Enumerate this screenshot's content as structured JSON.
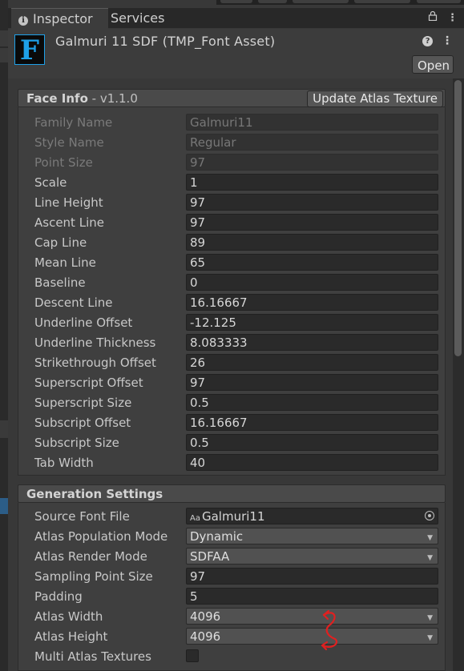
{
  "tabs": [
    {
      "label": "Inspector",
      "icon": "info-icon",
      "active": true
    },
    {
      "label": "Services",
      "active": false
    }
  ],
  "header": {
    "icon_letter": "F",
    "title": "Galmuri 11 SDF (TMP_Font Asset)",
    "open_label": "Open",
    "icons": [
      "help-icon",
      "more-icon"
    ]
  },
  "face_info": {
    "title": "Face Info",
    "version": " - v1.1.0",
    "update_label": "Update Atlas Texture",
    "rows": [
      {
        "label": "Family Name",
        "value": "Galmuri11",
        "disabled": true
      },
      {
        "label": "Style Name",
        "value": "Regular",
        "disabled": true
      },
      {
        "label": "Point Size",
        "value": "97",
        "disabled": true
      },
      {
        "label": "Scale",
        "value": "1"
      },
      {
        "label": "Line Height",
        "value": "97"
      },
      {
        "label": "Ascent Line",
        "value": "97"
      },
      {
        "label": "Cap Line",
        "value": "89"
      },
      {
        "label": "Mean Line",
        "value": "65"
      },
      {
        "label": "Baseline",
        "value": "0"
      },
      {
        "label": "Descent Line",
        "value": "16.16667"
      },
      {
        "label": "Underline Offset",
        "value": "-12.125"
      },
      {
        "label": "Underline Thickness",
        "value": "8.083333"
      },
      {
        "label": "Strikethrough Offset",
        "value": "26"
      },
      {
        "label": "Superscript Offset",
        "value": "97"
      },
      {
        "label": "Superscript Size",
        "value": "0.5"
      },
      {
        "label": "Subscript Offset",
        "value": "16.16667"
      },
      {
        "label": "Subscript Size",
        "value": "0.5"
      },
      {
        "label": "Tab Width",
        "value": "40"
      }
    ]
  },
  "generation": {
    "title": "Generation Settings",
    "rows": [
      {
        "label": "Source Font File",
        "value": "Galmuri11",
        "kind": "object",
        "prefix": "Aa"
      },
      {
        "label": "Atlas Population Mode",
        "value": "Dynamic",
        "kind": "dropdown"
      },
      {
        "label": "Atlas Render Mode",
        "value": "SDFAA",
        "kind": "dropdown"
      },
      {
        "label": "Sampling Point Size",
        "value": "97",
        "kind": "text"
      },
      {
        "label": "Padding",
        "value": "5",
        "kind": "text"
      },
      {
        "label": "Atlas Width",
        "value": "4096",
        "kind": "dropdown"
      },
      {
        "label": "Atlas Height",
        "value": "4096",
        "kind": "dropdown"
      },
      {
        "label": "Multi Atlas Textures",
        "value": "",
        "kind": "checkbox",
        "checked": false
      }
    ]
  },
  "colors": {
    "asset_icon": "#1ea0e8",
    "annotation": "#e02020",
    "selection": "#2c5d87"
  }
}
